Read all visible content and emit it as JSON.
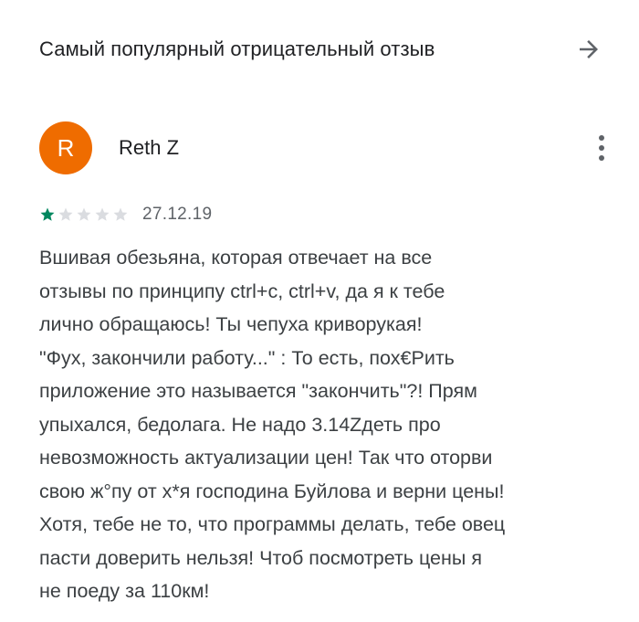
{
  "header": {
    "title": "Самый популярный отрицательный отзыв",
    "arrow_icon": "arrow-right-icon"
  },
  "review": {
    "avatar_letter": "R",
    "avatar_color": "#ef6c00",
    "author": "Reth Z",
    "rating": 1,
    "rating_max": 5,
    "star_filled_color": "#01875f",
    "star_empty_color": "#dadce0",
    "date": "27.12.19",
    "text": "Вшивая обезьяна, которая отвечает на все\nотзывы по принципу ctrl+c, ctrl+v, да я к тебе\nлично обращаюсь! Ты чепуха криворукая!\n\"Фух, закончили работу...\" : То есть, пох€Рить\nприложение это называется \"закончить\"?! Прям\nупыхался, бедолага. Не надо 3.14Zдеть про\nневозможность актуализации цен! Так что оторви\nсвою ж°пу от х*я господина Буйлова и верни цены!\nХотя, тебе не то, что программы делать, тебе овец\nпасти доверить нельзя! Чтоб посмотреть цены я\nне поеду за 110км!"
  }
}
